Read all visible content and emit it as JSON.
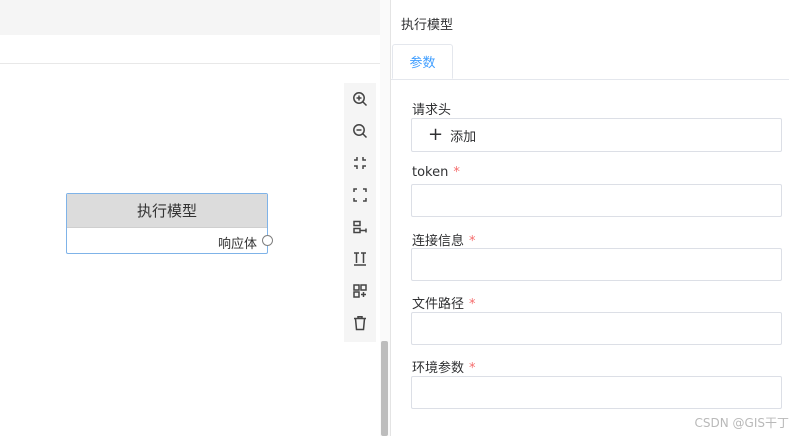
{
  "panel": {
    "title": "执行模型",
    "tabs": [
      {
        "label": "参数"
      }
    ],
    "header_section": {
      "label": "请求头",
      "add_label": "添加",
      "add_icon": "plus-icon"
    },
    "fields": [
      {
        "label": "token",
        "required_mark": "*",
        "value": ""
      },
      {
        "label": "连接信息",
        "required_mark": "*",
        "value": ""
      },
      {
        "label": "文件路径",
        "required_mark": "*",
        "value": ""
      },
      {
        "label": "环境参数",
        "required_mark": "*",
        "value": ""
      }
    ]
  },
  "canvas": {
    "node": {
      "title": "执行模型",
      "port_label": "响应体"
    },
    "toolbar": [
      {
        "name": "zoom-in-icon"
      },
      {
        "name": "zoom-out-icon"
      },
      {
        "name": "shrink-icon"
      },
      {
        "name": "fullscreen-icon"
      },
      {
        "name": "align-horizontal-icon"
      },
      {
        "name": "align-vertical-icon"
      },
      {
        "name": "auto-layout-icon"
      },
      {
        "name": "delete-icon"
      }
    ]
  },
  "watermark": "CSDN @GIS干丁",
  "colors": {
    "accent": "#409eff",
    "required": "#f56c6c",
    "node_border": "#7fb3e8",
    "node_header": "#dcdcdc"
  }
}
